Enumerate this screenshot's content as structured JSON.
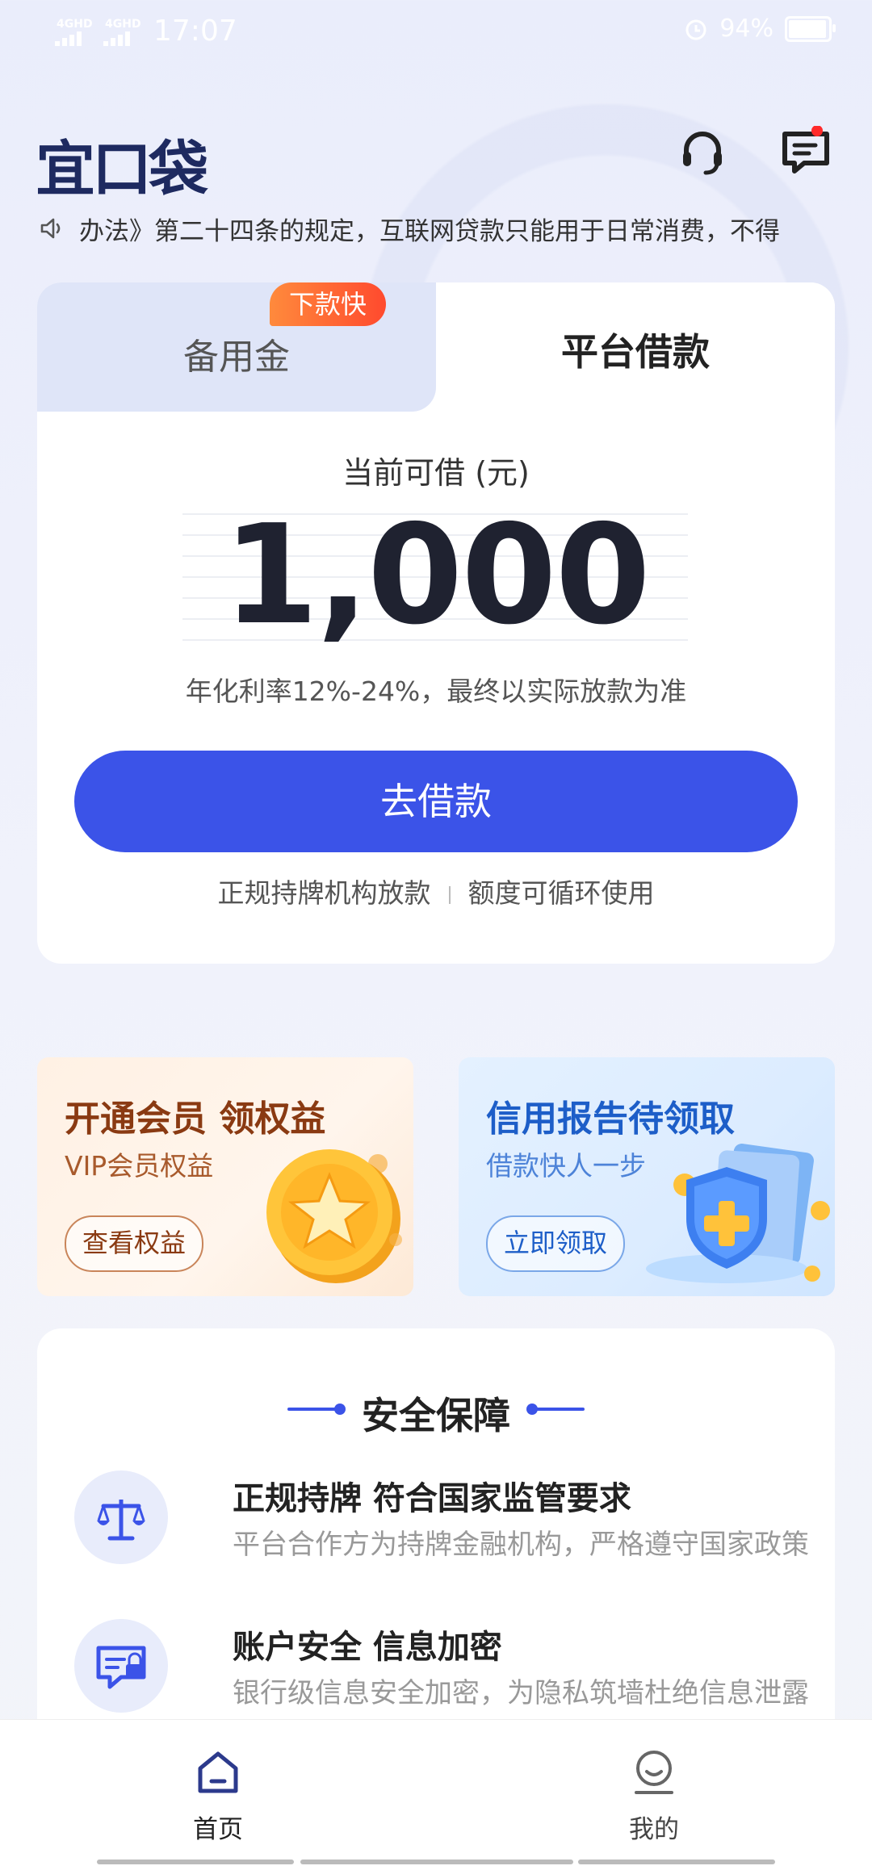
{
  "status_bar": {
    "network1": "4GHD",
    "network2": "4GHD",
    "time": "17:07",
    "battery": "94%"
  },
  "header": {
    "logo": "宜口袋",
    "service_icon": "headset-icon",
    "message_icon": "message-icon"
  },
  "notice": {
    "text": "办法》第二十四条的规定，互联网贷款只能用于日常消费，不得"
  },
  "loan_card": {
    "tabs": [
      {
        "label": "备用金"
      },
      {
        "label": "平台借款"
      }
    ],
    "badge": "下款快",
    "available_label": "当前可借 (元)",
    "amount": "1,000",
    "rate_text": "年化利率12%-24%，最终以实际放款为准",
    "borrow_button": "去借款",
    "tags": [
      "正规持牌机构放款",
      "额度可循环使用"
    ]
  },
  "promos": [
    {
      "title": "开通会员 领权益",
      "subtitle": "VIP会员权益",
      "button": "查看权益"
    },
    {
      "title": "信用报告待领取",
      "subtitle": "借款快人一步",
      "button": "立即领取"
    }
  ],
  "security": {
    "title": "安全保障",
    "items": [
      {
        "title": "正规持牌 符合国家监管要求",
        "desc": "平台合作方为持牌金融机构，严格遵守国家政策",
        "icon": "scale-icon"
      },
      {
        "title": "账户安全 信息加密",
        "desc": "银行级信息安全加密，为隐私筑墙杜绝信息泄露",
        "icon": "secure-card-icon"
      }
    ]
  },
  "bottom_nav": [
    {
      "label": "首页",
      "icon": "home-icon"
    },
    {
      "label": "我的",
      "icon": "profile-icon"
    }
  ],
  "colors": {
    "primary": "#3b53e8",
    "badge": "#ff5a2e",
    "dark": "#1f2230"
  }
}
